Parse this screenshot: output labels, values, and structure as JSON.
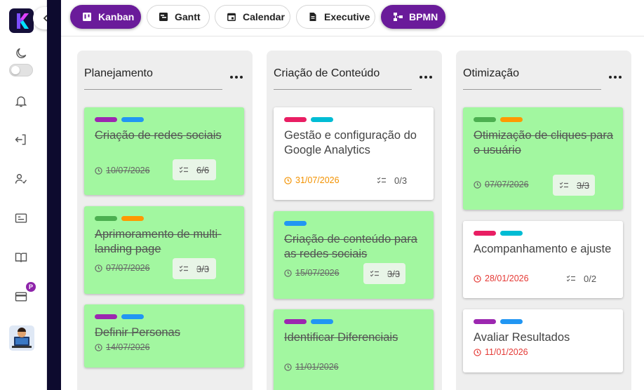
{
  "app": {
    "logo_letter": "K"
  },
  "sidebar": {
    "badge_label": "P",
    "icons": [
      "moon-icon",
      "bell-icon",
      "logout-icon",
      "user-check-icon",
      "id-card-icon",
      "book-icon",
      "credit-card-icon"
    ]
  },
  "tabs": [
    {
      "label": "Kanban",
      "active": true
    },
    {
      "label": "Gantt",
      "active": false
    },
    {
      "label": "Calendar",
      "active": false
    },
    {
      "label": "Executive",
      "active": false
    },
    {
      "label": "BPMN",
      "active": true
    }
  ],
  "colors": {
    "purple": "#9c27b0",
    "blue": "#2196f3",
    "green": "#4caf50",
    "orange": "#ff9800",
    "pink": "#e91e63",
    "cyan": "#00bcd4",
    "done_card": "#a2f7a0",
    "orange_date": "#f39200",
    "red_date": "#e53935"
  },
  "columns": [
    {
      "title": "Planejamento",
      "cards": [
        {
          "title": "Criação de redes sociais",
          "date": "10/07/2026",
          "checklist": "6/6",
          "done": true
        },
        {
          "title": "Aprimoramento de multi-landing page",
          "date": "07/07/2026",
          "checklist": "3/3",
          "done": true
        },
        {
          "title": "Definir Personas",
          "date": "14/07/2026",
          "done": true
        }
      ]
    },
    {
      "title": "Criação de Conteúdo",
      "cards": [
        {
          "title": "Gestão e configuração do Google Analytics",
          "date": "31/07/2026",
          "checklist": "0/3",
          "done": false
        },
        {
          "title": "Criação de conteúdo para as redes sociais",
          "date": "15/07/2026",
          "checklist": "3/3",
          "done": true
        },
        {
          "title": "Identificar Diferenciais",
          "date": "11/01/2026",
          "done": true
        }
      ]
    },
    {
      "title": "Otimização",
      "cards": [
        {
          "title": "Otimização de cliques para o usuário",
          "date": "07/07/2026",
          "checklist": "3/3",
          "done": true
        },
        {
          "title": "Acompanhamento e ajuste",
          "date": "28/01/2026",
          "checklist": "0/2",
          "done": false
        },
        {
          "title": "Avaliar Resultados",
          "date": "11/01/2026",
          "done": false
        }
      ]
    }
  ]
}
